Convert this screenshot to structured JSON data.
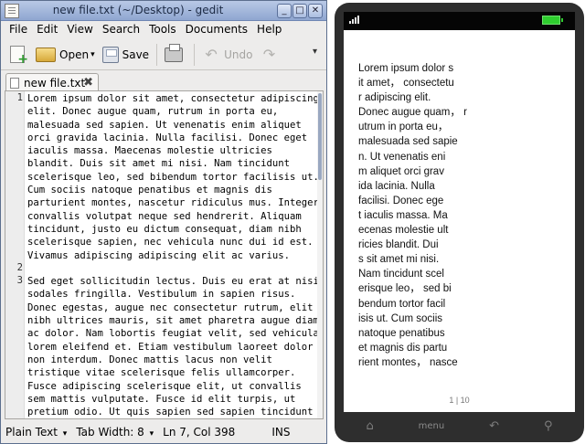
{
  "gedit": {
    "title": "new file.txt (~/Desktop) - gedit",
    "window_buttons": {
      "minimize": "_",
      "maximize": "□",
      "close": "✕"
    },
    "menu": [
      "File",
      "Edit",
      "View",
      "Search",
      "Tools",
      "Documents",
      "Help"
    ],
    "toolbar": {
      "open_label": "Open",
      "save_label": "Save",
      "undo_label": "Undo"
    },
    "tab": {
      "label": "new file.txt",
      "close": "✖"
    },
    "line_numbers": [
      "1",
      "2",
      "3"
    ],
    "lines": [
      "Lorem ipsum dolor sit amet, consectetur adipiscing",
      "elit. Donec augue quam, rutrum in porta eu,",
      "malesuada sed sapien. Ut venenatis enim aliquet",
      "orci gravida lacinia. Nulla facilisi. Donec eget",
      "iaculis massa. Maecenas molestie ultricies",
      "blandit. Duis sit amet mi nisi. Nam tincidunt",
      "scelerisque leo, sed bibendum tortor facilisis ut.",
      "Cum sociis natoque penatibus et magnis dis",
      "parturient montes, nascetur ridiculus mus. Integer",
      "convallis volutpat neque sed hendrerit. Aliquam",
      "tincidunt, justo eu dictum consequat, diam nibh",
      "scelerisque sapien, nec vehicula nunc dui id est.",
      "Vivamus adipiscing adipiscing elit ac varius.",
      "",
      "Sed eget sollicitudin lectus. Duis eu erat at nisi",
      "sodales fringilla. Vestibulum in sapien risus.",
      "Donec egestas, augue nec consectetur rutrum, elit",
      "nibh ultrices mauris, sit amet pharetra augue diam",
      "ac dolor. Nam lobortis feugiat velit, sed vehicula",
      "lorem eleifend et. Etiam vestibulum laoreet dolor",
      "non interdum. Donec mattis lacus non velit",
      "tristique vitae scelerisque felis ullamcorper.",
      "Fusce adipiscing scelerisque elit, ut convallis",
      "sem mattis vulputate. Fusce id elit turpis, ut",
      "pretium odio. Ut quis sapien sed sapien tincidunt"
    ],
    "status": {
      "language": "Plain Text",
      "tab_width": "Tab Width:  8",
      "position": "Ln 7, Col 398",
      "mode": "INS"
    }
  },
  "phone": {
    "reader_lines": [
      "Lorem ipsum dolor s",
      "it amet， consectetu",
      "r adipiscing elit.",
      "Donec augue quam， r",
      "utrum in porta eu，",
      "malesuada sed sapie",
      "n. Ut venenatis eni",
      "m aliquet orci grav",
      "ida lacinia. Nulla",
      "facilisi. Donec ege",
      "t iaculis massa. Ma",
      "ecenas molestie ult",
      "ricies blandit. Dui",
      "s sit amet mi nisi.",
      "Nam tincidunt scel",
      "erisque leo， sed bi",
      "bendum tortor facil",
      "isis ut. Cum sociis",
      "natoque penatibus",
      "et magnis dis partu",
      "rient montes， nasce"
    ],
    "page_indicator": "1 | 10",
    "nav": {
      "home": "⌂",
      "menu": "menu",
      "back": "↶",
      "search": "⚲"
    }
  }
}
